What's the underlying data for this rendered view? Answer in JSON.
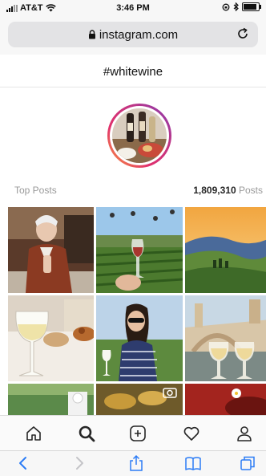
{
  "status_bar": {
    "carrier": "AT&T",
    "time": "3:46 PM",
    "wifi_icon": "wifi-icon",
    "battery_icon": "battery-icon"
  },
  "browser": {
    "url": "instagram.com",
    "lock_icon": "lock-icon",
    "reload_icon": "reload-icon"
  },
  "page": {
    "hashtag": "#whitewine",
    "section_label": "Top Posts",
    "post_count": "1,809,310",
    "post_count_unit": "Posts"
  },
  "ig_tabs": [
    "home-icon",
    "search-icon",
    "add-post-icon",
    "activity-heart-icon",
    "profile-icon"
  ],
  "safari_toolbar": [
    "back-icon",
    "forward-icon",
    "share-icon",
    "bookmarks-icon",
    "tabs-icon"
  ],
  "colors": {
    "accent": "#262626",
    "safari_blue": "#2b7cf6",
    "muted": "#999999"
  }
}
